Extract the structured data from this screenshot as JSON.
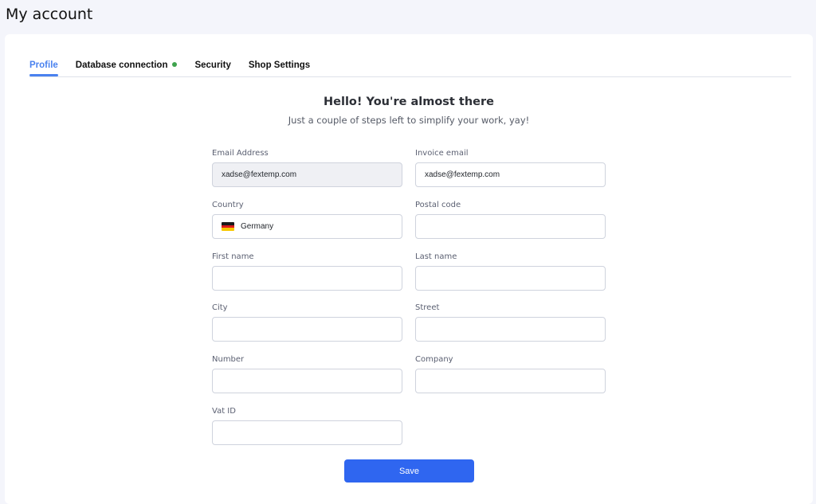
{
  "header": {
    "title": "My account"
  },
  "tabs": [
    {
      "label": "Profile",
      "active": true
    },
    {
      "label": "Database connection",
      "status": "connected",
      "status_color": "#3fa34d"
    },
    {
      "label": "Security"
    },
    {
      "label": "Shop Settings"
    }
  ],
  "intro": {
    "title": "Hello! You're almost there",
    "subtitle": "Just a couple of steps left to simplify your work, yay!"
  },
  "form": {
    "email": {
      "label": "Email Address",
      "value": "xadse@fextemp.com",
      "readonly": true
    },
    "invoice_email": {
      "label": "Invoice email",
      "value": "xadse@fextemp.com"
    },
    "country": {
      "label": "Country",
      "value": "Germany",
      "flag_icon": "germany-flag-icon"
    },
    "postal_code": {
      "label": "Postal code",
      "value": ""
    },
    "first_name": {
      "label": "First name",
      "value": ""
    },
    "last_name": {
      "label": "Last name",
      "value": ""
    },
    "city": {
      "label": "City",
      "value": ""
    },
    "street": {
      "label": "Street",
      "value": ""
    },
    "number": {
      "label": "Number",
      "value": ""
    },
    "company": {
      "label": "Company",
      "value": ""
    },
    "vat_id": {
      "label": "Vat ID",
      "value": ""
    },
    "save_label": "Save"
  },
  "colors": {
    "accent": "#2f66f0",
    "tab_active": "#4a82ef",
    "background": "#f4f5fb"
  }
}
